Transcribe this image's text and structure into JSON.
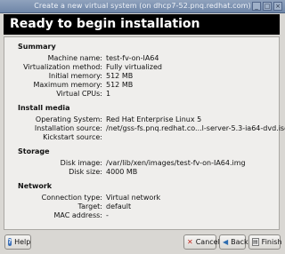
{
  "window": {
    "title": "Create a new virtual system (on dhcp7-52.pnq.redhat.com)"
  },
  "header": {
    "title": "Ready to begin installation"
  },
  "summary": {
    "heading": "Summary",
    "rows": [
      {
        "label": "Machine name:",
        "value": "test-fv-on-IA64"
      },
      {
        "label": "Virtualization method:",
        "value": "Fully virtualized"
      },
      {
        "label": "Initial memory:",
        "value": "512 MB"
      },
      {
        "label": "Maximum memory:",
        "value": "512 MB"
      },
      {
        "label": "Virtual CPUs:",
        "value": "1"
      }
    ]
  },
  "install_media": {
    "heading": "Install media",
    "rows": [
      {
        "label": "Operating System:",
        "value": "Red Hat Enterprise Linux 5"
      },
      {
        "label": "Installation source:",
        "value": "/net/gss-fs.pnq.redhat.co...l-server-5.3-ia64-dvd.iso"
      },
      {
        "label": "Kickstart source:",
        "value": ""
      }
    ]
  },
  "storage": {
    "heading": "Storage",
    "rows": [
      {
        "label": "Disk image:",
        "value": "/var/lib/xen/images/test-fv-on-IA64.img"
      },
      {
        "label": "Disk size:",
        "value": "4000 MB"
      }
    ]
  },
  "network": {
    "heading": "Network",
    "rows": [
      {
        "label": "Connection type:",
        "value": "Virtual network"
      },
      {
        "label": "Target:",
        "value": "default"
      },
      {
        "label": "MAC address:",
        "value": "-"
      }
    ]
  },
  "buttons": {
    "help": "Help",
    "cancel": "Cancel",
    "back": "Back",
    "finish": "Finish"
  },
  "icons": {
    "help": "help-icon",
    "cancel": "cancel-icon",
    "back": "back-arrow-icon",
    "finish": "finish-icon"
  }
}
